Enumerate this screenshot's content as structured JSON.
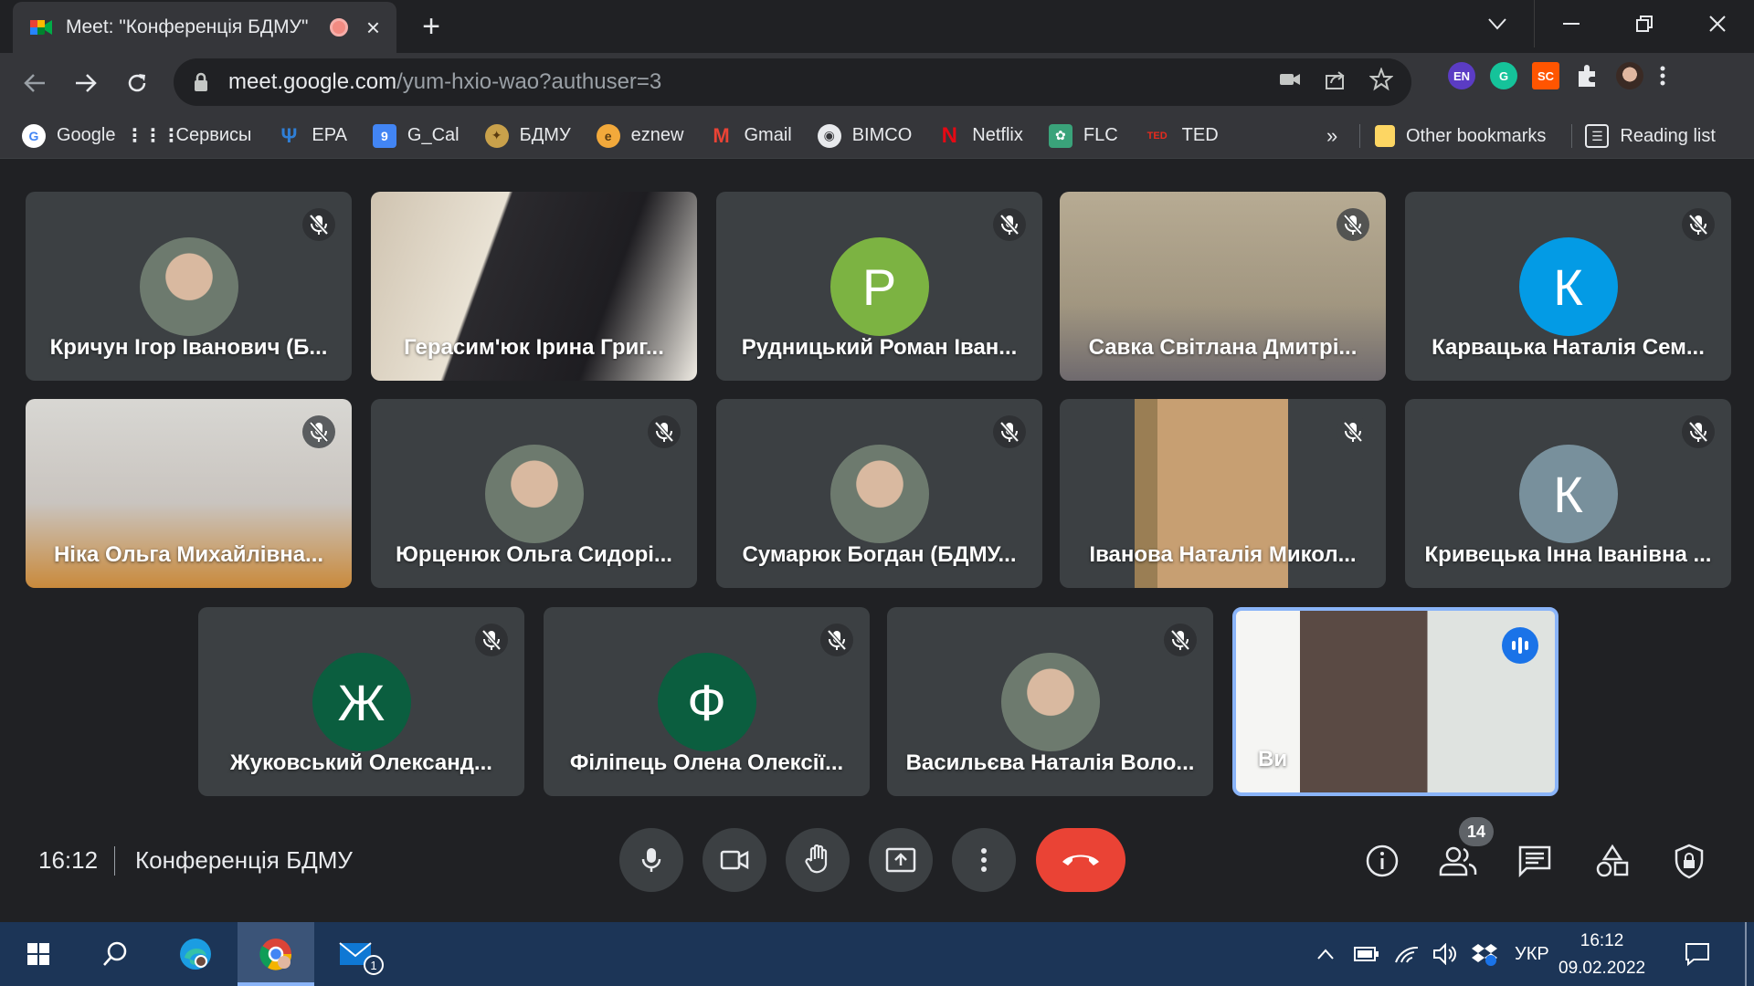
{
  "browser": {
    "tab_title": "Meet: \"Конференція БДМУ\"",
    "tab_close": "×",
    "new_tab": "+",
    "url_host": "meet.google.com",
    "url_path": "/yum-hxio-wao?authuser=3",
    "extensions": [
      {
        "label": "EN",
        "color": "#5b3cc4"
      },
      {
        "label": "G",
        "color": "#15c39a"
      },
      {
        "label": "SC",
        "color": "#ff5500"
      }
    ]
  },
  "bookmarks": {
    "items": [
      {
        "label": "Google",
        "icon": "google-icon",
        "color": "#4285f4"
      },
      {
        "label": "Сервисы",
        "icon": "apps-grid-icon",
        "color": "#e8eaed"
      },
      {
        "label": "EPA",
        "icon": "epa-icon",
        "color": "#2f7fd6"
      },
      {
        "label": "G_Cal",
        "icon": "calendar-icon",
        "color": "#4285f4"
      },
      {
        "label": "БДМУ",
        "icon": "bdmu-crest-icon",
        "color": "#c9a14b"
      },
      {
        "label": "eznew",
        "icon": "eznew-icon",
        "color": "#f2a93b"
      },
      {
        "label": "Gmail",
        "icon": "gmail-icon",
        "color": "#ea4335"
      },
      {
        "label": "BIMCO",
        "icon": "globe-icon",
        "color": "#e8eaed"
      },
      {
        "label": "Netflix",
        "icon": "netflix-icon",
        "color": "#e50914"
      },
      {
        "label": "FLC",
        "icon": "flc-icon",
        "color": "#3aa37a"
      },
      {
        "label": "TED",
        "icon": "ted-icon",
        "color": "#e62b1e"
      }
    ],
    "more": "»",
    "other_bookmarks": "Other bookmarks",
    "reading_list": "Reading list"
  },
  "participants": [
    {
      "name": "Кричун Ігор Іванович (Б...",
      "type": "photo",
      "muted": true
    },
    {
      "name": "Герасим'юк Ірина Григ...",
      "type": "video",
      "muted": false
    },
    {
      "name": "Рудницький Роман Іван...",
      "type": "letter",
      "letter": "Р",
      "color": "#7cb342",
      "muted": true
    },
    {
      "name": "Савка Світлана Дмитрі...",
      "type": "video",
      "muted": true
    },
    {
      "name": "Карвацька Наталія Сем...",
      "type": "letter",
      "letter": "К",
      "color": "#039be5",
      "muted": true
    },
    {
      "name": "Ніка Ольга Михайлівна...",
      "type": "video",
      "muted": true
    },
    {
      "name": "Юрценюк Ольга Сидорі...",
      "type": "photo",
      "muted": true
    },
    {
      "name": "Сумарюк Богдан (БДМУ...",
      "type": "photo",
      "muted": true
    },
    {
      "name": "Іванова Наталія Микол...",
      "type": "video",
      "muted": true
    },
    {
      "name": "Кривецька Інна Іванівна ...",
      "type": "letter",
      "letter": "К",
      "color": "#78909c",
      "muted": true
    },
    {
      "name": "Жуковський Олександ...",
      "type": "letter",
      "letter": "Ж",
      "color": "#0b5e3f",
      "muted": true
    },
    {
      "name": "Філіпець Олена Олексії...",
      "type": "letter",
      "letter": "Ф",
      "color": "#0b5e3f",
      "muted": true
    },
    {
      "name": "Васильєва Наталія Воло...",
      "type": "photo",
      "muted": true
    },
    {
      "name": "Ви",
      "type": "video",
      "muted": false,
      "speaking": true
    }
  ],
  "meeting": {
    "time": "16:12",
    "title": "Конференція БДМУ",
    "participant_count": "14"
  },
  "taskbar": {
    "mail_badge": "1",
    "language": "УКР",
    "time": "16:12",
    "date": "09.02.2022"
  }
}
